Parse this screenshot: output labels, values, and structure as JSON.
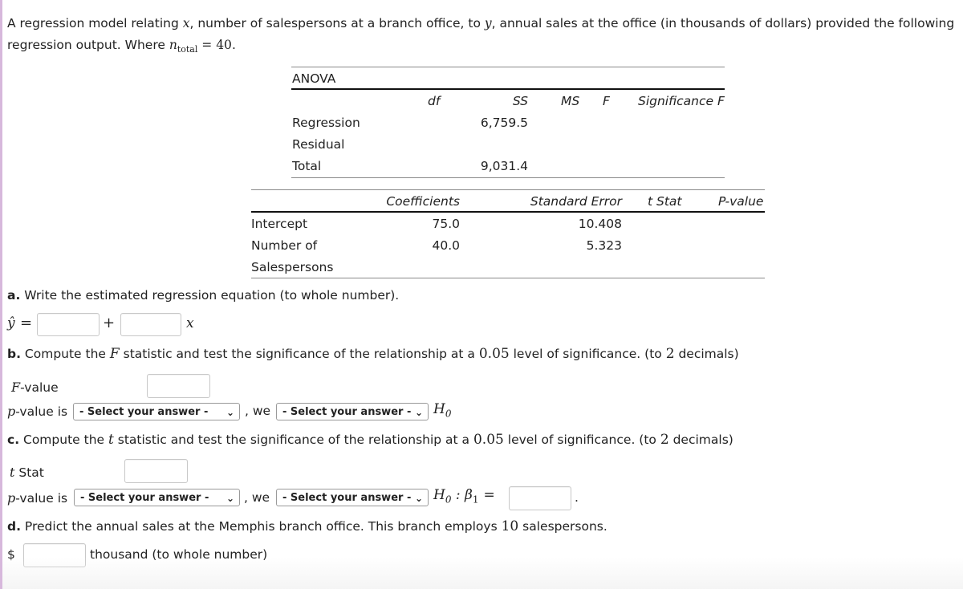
{
  "intro": {
    "part1": "A regression model relating ",
    "var_x": "x",
    "part2": ", number of salespersons at a branch office, to ",
    "var_y": "y",
    "part3": ", annual sales at the office (in thousands of dollars) provided the following regression output. Where ",
    "n_sym": "n",
    "n_sub": "total",
    "n_eq": " = 40",
    "end": "."
  },
  "anova": {
    "title": "ANOVA",
    "headers": [
      "df",
      "SS",
      "MS",
      "F",
      "Significance F"
    ],
    "rows": [
      {
        "label": "Regression",
        "df": "",
        "ss": "6,759.5"
      },
      {
        "label": "Residual",
        "df": "",
        "ss": ""
      },
      {
        "label": "Total",
        "df": "",
        "ss": "9,031.4"
      }
    ]
  },
  "coef": {
    "headers": [
      "Coefficients",
      "Standard Error",
      "t Stat",
      "P-value"
    ],
    "rows": [
      {
        "label": "Intercept",
        "coef": "75.0",
        "se": "10.408"
      },
      {
        "label": "Number of",
        "label2": "Salespersons",
        "coef": "40.0",
        "se": "5.323"
      }
    ]
  },
  "part_a": {
    "letter": "a.",
    "text": " Write the estimated regression equation (to whole number).",
    "yhat": "ŷ",
    "eq": "=",
    "plus": "+",
    "x": "x",
    "intercept_value": "",
    "slope_value": ""
  },
  "part_b": {
    "letter": "b.",
    "text1": " Compute the ",
    "F": "F",
    "text2": " statistic and test the significance of the relationship at a ",
    "alpha": "0.05",
    "text3": " level of significance. (to ",
    "dec": "2",
    "text4": " decimals)",
    "f_label_sym": "F",
    "f_label": "-value",
    "f_value": "",
    "p_sym": "p",
    "p_label": "-value is",
    "select1": "- Select your answer -",
    "we": ", we",
    "select2": "- Select your answer -",
    "h0": "H",
    "h0_sub": "0"
  },
  "part_c": {
    "letter": "c.",
    "text1": " Compute the ",
    "t": "t",
    "text2": " statistic and test the significance of the relationship at a ",
    "alpha": "0.05",
    "text3": " level of significance. (to ",
    "dec": "2",
    "text4": " decimals)",
    "t_label_sym": "t",
    "t_label": " Stat",
    "t_value": "",
    "p_sym": "p",
    "p_label": "-value is",
    "select1": "- Select your answer -",
    "we": ", we",
    "select2": "- Select your answer -",
    "h0": "H",
    "h0_sub": "0",
    "colon": " : ",
    "beta": "β",
    "beta_sub": "1",
    "eq": "=",
    "beta_value": "",
    "period": "."
  },
  "part_d": {
    "letter": "d.",
    "text1": " Predict the annual sales at the Memphis branch office. This branch employs ",
    "n": "10",
    "text2": " salespersons.",
    "dollar": "$",
    "value": "",
    "unit": "thousand (to whole number)"
  }
}
